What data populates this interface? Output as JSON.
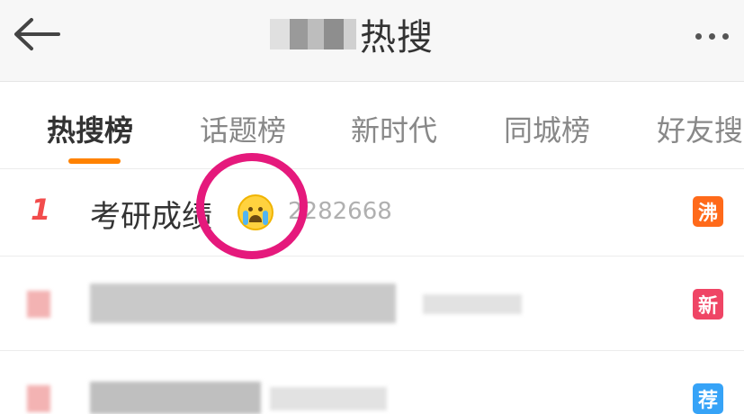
{
  "header": {
    "title": "热搜",
    "back_icon": "arrow-left-icon",
    "more_icon": "more-dots-icon"
  },
  "tabs": [
    {
      "label": "热搜榜",
      "active": true
    },
    {
      "label": "话题榜",
      "active": false
    },
    {
      "label": "新时代",
      "active": false
    },
    {
      "label": "同城榜",
      "active": false
    },
    {
      "label": "好友搜",
      "active": false
    }
  ],
  "list": [
    {
      "rank": "1",
      "topic": "考研成绩",
      "emoji_icon": "crying-face-icon",
      "count": "2282668",
      "badge": "沸",
      "badge_color": "#ff6a1a"
    },
    {
      "rank": "",
      "topic": "",
      "count": "",
      "badge": "新",
      "badge_color": "#ef4565"
    },
    {
      "rank": "",
      "topic": "",
      "count": "",
      "badge": "荐",
      "badge_color": "#36a3f7"
    }
  ],
  "colors": {
    "accent": "#ff8200",
    "annotation": "#e5197c"
  }
}
